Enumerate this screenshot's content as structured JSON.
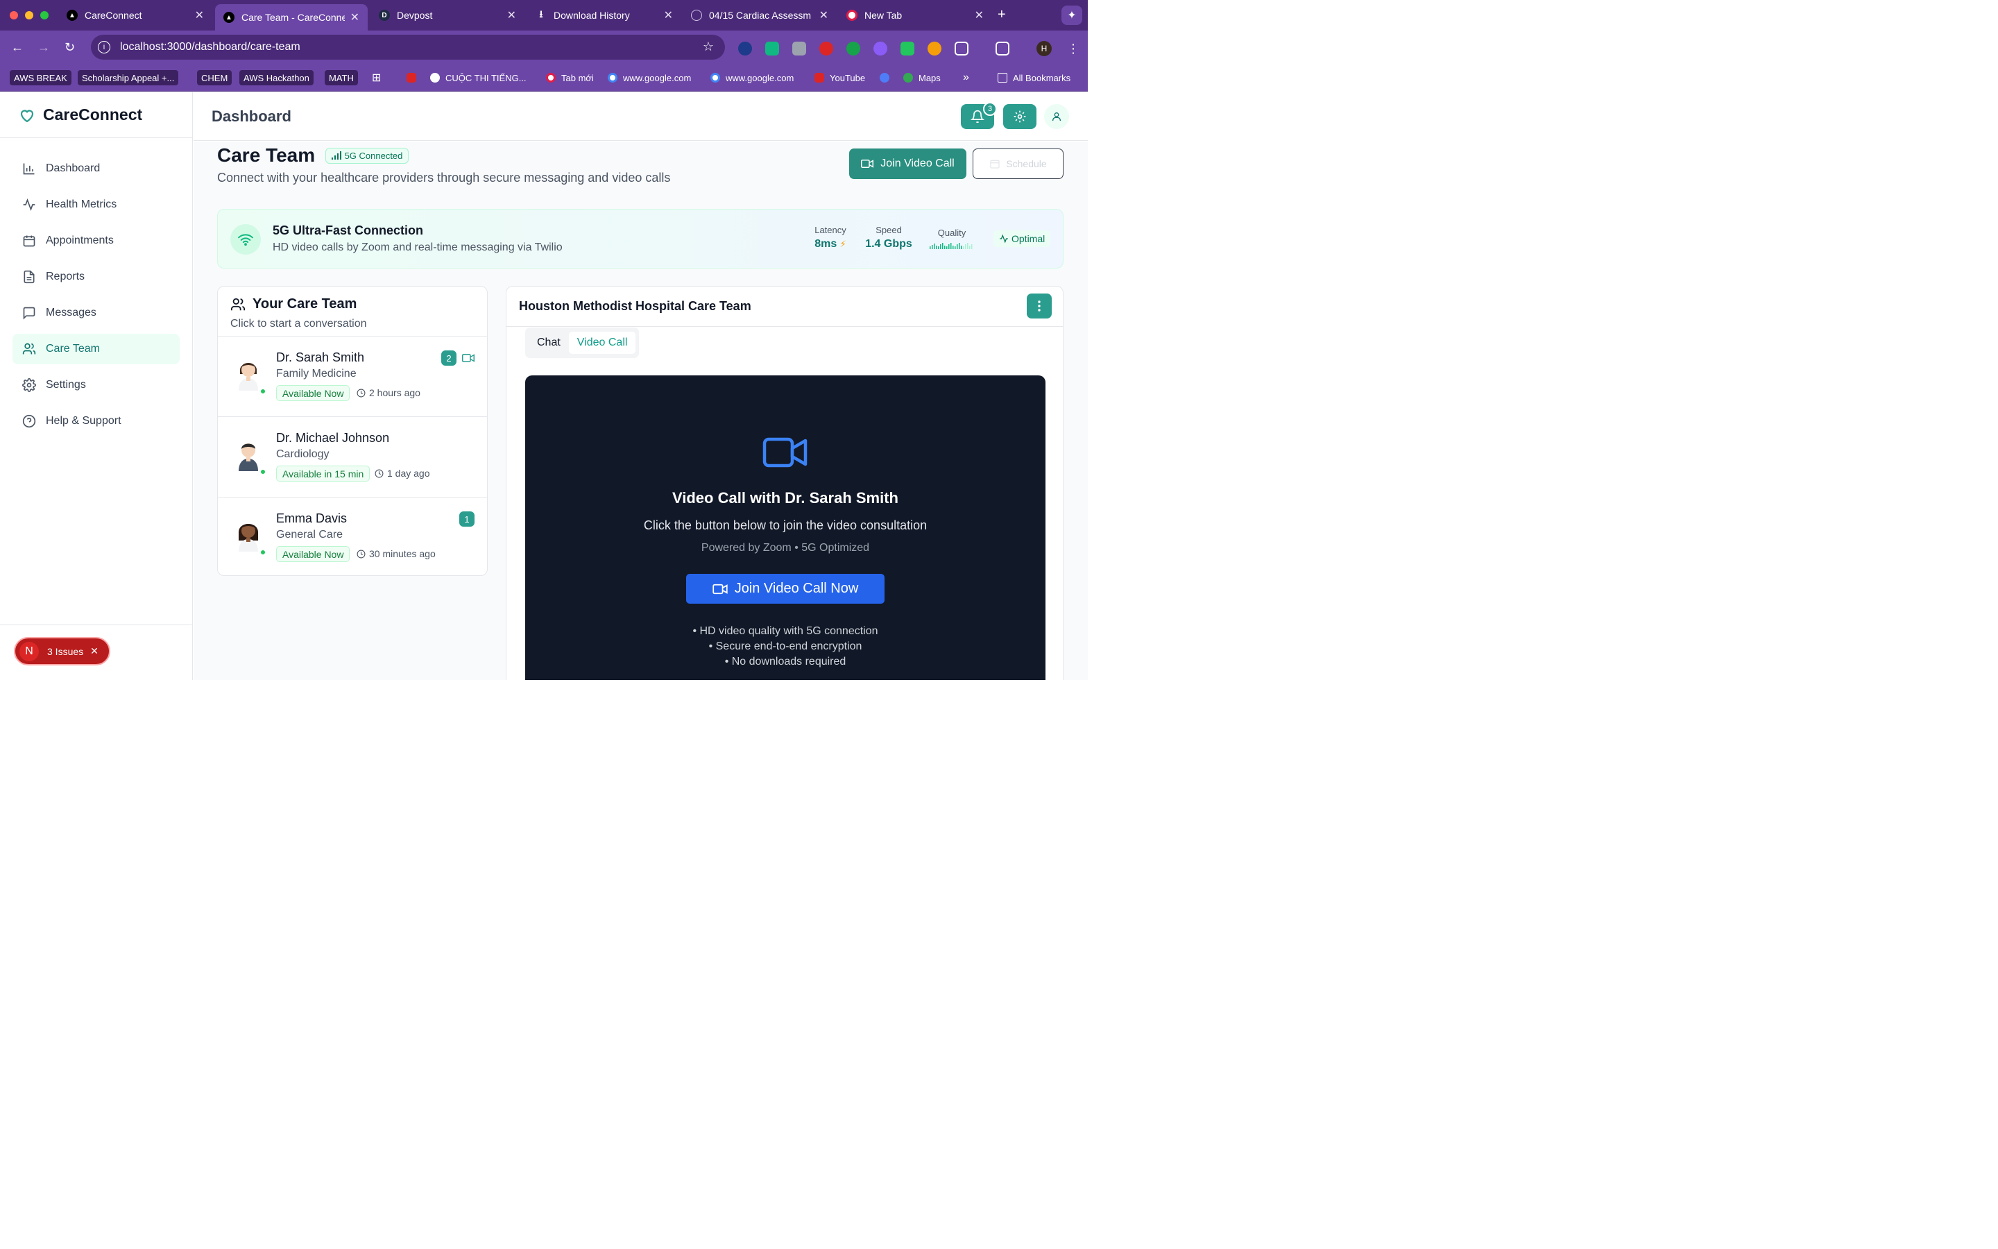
{
  "browser": {
    "tabs": [
      {
        "title": "CareConnect"
      },
      {
        "title": "Care Team - CareConne"
      },
      {
        "title": "Devpost"
      },
      {
        "title": "Download History"
      },
      {
        "title": "04/15 Cardiac Assessm"
      },
      {
        "title": "New Tab"
      }
    ],
    "url": "localhost:3000/dashboard/care-team",
    "profile_initial": "H",
    "bookmarks": [
      "AWS BREAK",
      "Scholarship Appeal +...",
      "CHEM",
      "AWS Hackathon",
      "MATH",
      "CUỘC THI TIẾNG...",
      "Tab mới",
      "www.google.com",
      "www.google.com",
      "YouTube",
      "Maps"
    ],
    "all_bookmarks": "All Bookmarks"
  },
  "app": {
    "brand": "CareConnect",
    "nav": [
      {
        "label": "Dashboard",
        "icon": "bar-chart-icon"
      },
      {
        "label": "Health Metrics",
        "icon": "activity-icon"
      },
      {
        "label": "Appointments",
        "icon": "calendar-icon"
      },
      {
        "label": "Reports",
        "icon": "file-text-icon"
      },
      {
        "label": "Messages",
        "icon": "message-icon"
      },
      {
        "label": "Care Team",
        "icon": "users-icon"
      },
      {
        "label": "Settings",
        "icon": "gear-icon"
      },
      {
        "label": "Help & Support",
        "icon": "help-circle-icon"
      }
    ],
    "active_nav": "Care Team",
    "issues": {
      "initial": "N",
      "label": "3 Issues"
    },
    "topbar": {
      "title": "Dashboard",
      "notification_count": "3"
    },
    "accent": "#2a9d8f"
  },
  "page": {
    "title": "Care Team",
    "connection_pill": "5G Connected",
    "subtitle": "Connect with your healthcare providers through secure messaging and video calls",
    "join_button": "Join Video Call",
    "schedule_button": "Schedule"
  },
  "connection": {
    "title": "5G Ultra-Fast Connection",
    "description": "HD video calls by Zoom and real-time messaging via Twilio",
    "latency_label": "Latency",
    "latency_value": "8ms",
    "speed_label": "Speed",
    "speed_value": "1.4 Gbps",
    "quality_label": "Quality",
    "status": "Optimal"
  },
  "team": {
    "title": "Your Care Team",
    "subtitle": "Click to start a conversation",
    "members": [
      {
        "name": "Dr. Sarah Smith",
        "specialty": "Family Medicine",
        "availability": "Available Now",
        "last_seen": "2 hours ago",
        "unread": "2"
      },
      {
        "name": "Dr. Michael Johnson",
        "specialty": "Cardiology",
        "availability": "Available in 15 min",
        "last_seen": "1 day ago"
      },
      {
        "name": "Emma Davis",
        "specialty": "General Care",
        "availability": "Available Now",
        "last_seen": "30 minutes ago",
        "unread": "1"
      }
    ]
  },
  "chat": {
    "title": "Houston Methodist Hospital Care Team",
    "tabs": [
      "Chat",
      "Video Call"
    ],
    "active_tab": "Video Call",
    "video": {
      "title": "Video Call with Dr. Sarah Smith",
      "subtitle": "Click the button below to join the video consultation",
      "powered": "Powered by Zoom • 5G Optimized",
      "button": "Join Video Call Now",
      "features": [
        "• HD video quality with 5G connection",
        "• Secure end-to-end encryption",
        "• No downloads required"
      ]
    }
  }
}
